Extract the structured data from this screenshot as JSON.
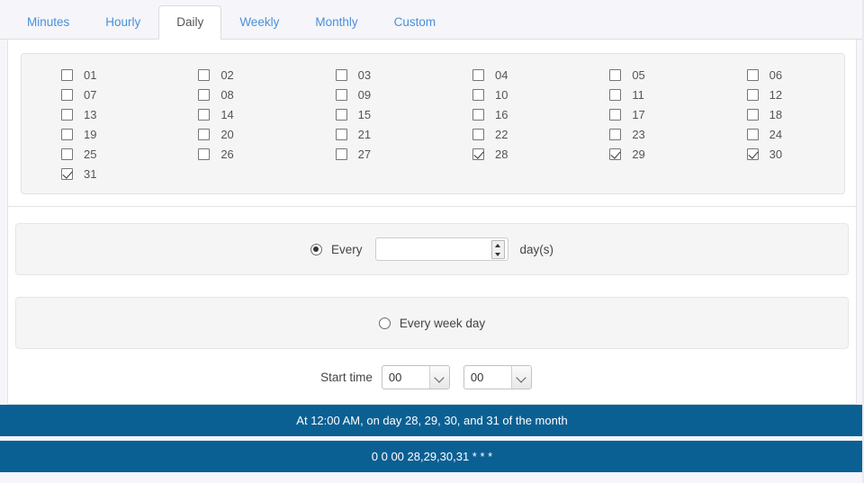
{
  "tabs": [
    {
      "label": "Minutes",
      "active": false
    },
    {
      "label": "Hourly",
      "active": false
    },
    {
      "label": "Daily",
      "active": true
    },
    {
      "label": "Weekly",
      "active": false
    },
    {
      "label": "Monthly",
      "active": false
    },
    {
      "label": "Custom",
      "active": false
    }
  ],
  "day_grid": {
    "rows": [
      [
        "01",
        "02",
        "03",
        "04",
        "05",
        "06"
      ],
      [
        "07",
        "08",
        "09",
        "10",
        "11",
        "12"
      ],
      [
        "13",
        "14",
        "15",
        "16",
        "17",
        "18"
      ],
      [
        "19",
        "20",
        "21",
        "22",
        "23",
        "24"
      ],
      [
        "25",
        "26",
        "27",
        "28",
        "29",
        "30"
      ],
      [
        "31",
        "",
        "",
        "",
        "",
        ""
      ]
    ],
    "checked": [
      "28",
      "29",
      "30",
      "31"
    ]
  },
  "every_option": {
    "label": "Every",
    "unit_label": "day(s)",
    "value": "",
    "placeholder": "",
    "selected": true
  },
  "weekday_option": {
    "label": "Every week day",
    "selected": false
  },
  "start_time": {
    "label": "Start time",
    "hour": "00",
    "minute": "00"
  },
  "banners": {
    "description": "At 12:00 AM, on day 28, 29, 30, and 31 of the month",
    "cron": "0 0 00 28,29,30,31 * * *",
    "color": "#0b6093"
  }
}
